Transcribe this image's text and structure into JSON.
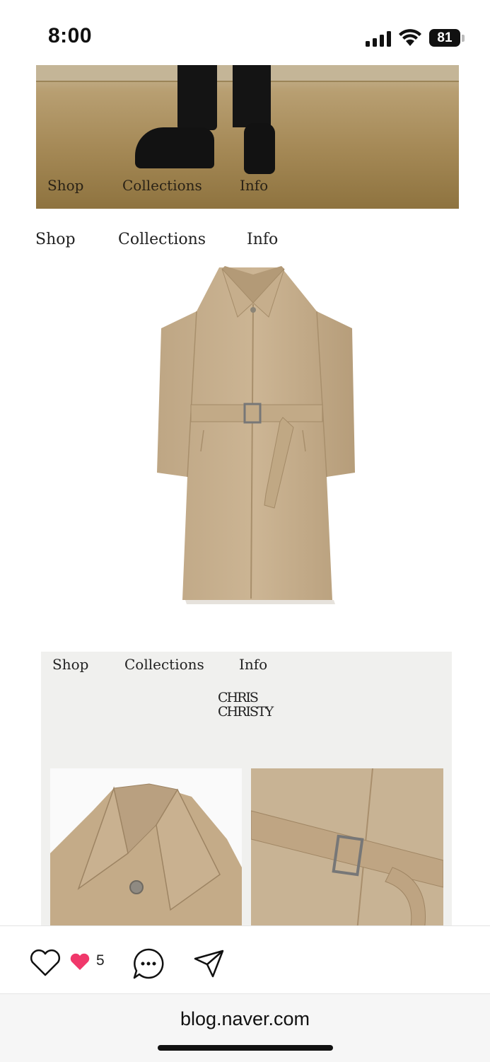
{
  "status_bar": {
    "time": "8:00",
    "battery": "81"
  },
  "hero": {
    "nav": [
      "Shop",
      "Collections",
      "Info"
    ]
  },
  "nav": [
    "Shop",
    "Collections",
    "Info"
  ],
  "panel": {
    "nav": [
      "Shop",
      "Collections",
      "Info"
    ],
    "logo_line1": "CHRIS",
    "logo_line2": "CHRISTY"
  },
  "actions": {
    "like_icon": "heart-outline-icon",
    "liked_icon": "heart-filled-icon",
    "like_count": "5",
    "comment_icon": "comment-bubble-icon",
    "share_icon": "send-icon",
    "liked_color": "#f0386b"
  },
  "browser": {
    "url": "blog.naver.com"
  }
}
